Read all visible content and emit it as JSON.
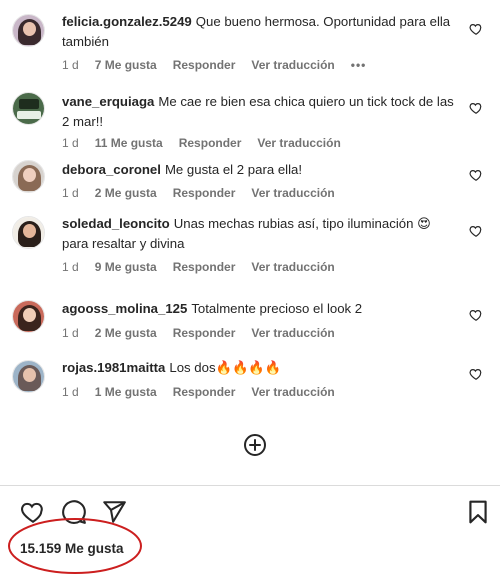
{
  "comments": [
    {
      "username": "felicia.gonzalez.5249",
      "text": "Que bueno hermosa. Oportunidad para ella también",
      "time": "1 d",
      "likes": "7 Me gusta",
      "reply": "Responder",
      "translate": "Ver traducción",
      "more": "•••"
    },
    {
      "username": "vane_erquiaga",
      "text": "Me cae re bien esa chica quiero un tick tock de las 2 mar!!",
      "time": "1 d",
      "likes": "11 Me gusta",
      "reply": "Responder",
      "translate": "Ver traducción"
    },
    {
      "username": "debora_coronel",
      "text": "Me gusta el 2 para ella!",
      "time": "1 d",
      "likes": "2 Me gusta",
      "reply": "Responder",
      "translate": "Ver traducción"
    },
    {
      "username": "soledad_leoncito",
      "text": "Unas mechas rubias así, tipo iluminación 😍 para resaltar y divina",
      "time": "1 d",
      "likes": "9 Me gusta",
      "reply": "Responder",
      "translate": "Ver traducción"
    },
    {
      "username": "agooss_molina_125",
      "text": "Totalmente precioso el look 2",
      "time": "1 d",
      "likes": "2 Me gusta",
      "reply": "Responder",
      "translate": "Ver traducción"
    },
    {
      "username": "rojas.1981maitta",
      "text": "Los dos🔥🔥🔥🔥",
      "time": "1 d",
      "likes": "1 Me gusta",
      "reply": "Responder",
      "translate": "Ver traducción"
    }
  ],
  "footer": {
    "likes_total": "15.159 Me gusta"
  },
  "colors": {
    "annotation": "#cc1f1f",
    "secondary_text": "#737373",
    "primary_text": "#262626"
  }
}
